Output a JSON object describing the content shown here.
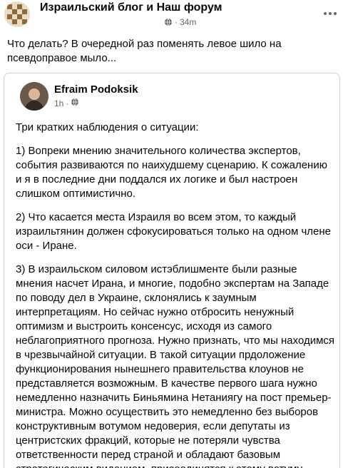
{
  "post": {
    "group_name": "Израильский блог и Наш форум",
    "time": "34m",
    "text": "Что делать? В очередной раз поменять левое шило на псевдоправое мыло..."
  },
  "icons": {
    "privacy": "globe-icon",
    "more": "more-options-icon"
  },
  "shared": {
    "author": "Efraim Podoksik",
    "time": "1h",
    "paragraphs": [
      "Три кратких наблюдения о ситуации:",
      "1) Вопреки мнению значительного количества экспертов, события развиваются по наихудшему сценарию. К сожалению и я в последние дни поддался их логике и был настроен слишком оптимистично.",
      "2) Что касается места Израиля во всем этом, то каждый израильтянин должен сфокусироваться только на одном члене оси - Иране.",
      "3) В израильском силовом истэблишменте были разные мнения насчет Ирана, и многие, подобно экспертам на Западе по поводу дел в Украине, склонялись к заумным интерпретациям. Но сейчас нужно отбросить ненужный оптимизм и выстроить консенсус, исходя из самого неблагоприятного прогноза. Нужно признать, что мы находимся в чрезвычайной ситуации. В такой ситуации прдоложение функционирования нынешнего правительства клоунов не представляется возможным. В качестве первого шага нужно немедленно назначить Биньямина Нетаниягу на пост премьер-министра. Можно осуществить это немедленно без выборов конструктивным вотумом недоверия, если депутаты из центристских фракций, которые не потеряли чувства ответственности перед страной и обладают базовым стратегическим видением, присоединятся к этому вотуму."
    ]
  },
  "colors": {
    "text": "#050505",
    "secondary": "#65676b",
    "border": "#ced0d4"
  }
}
